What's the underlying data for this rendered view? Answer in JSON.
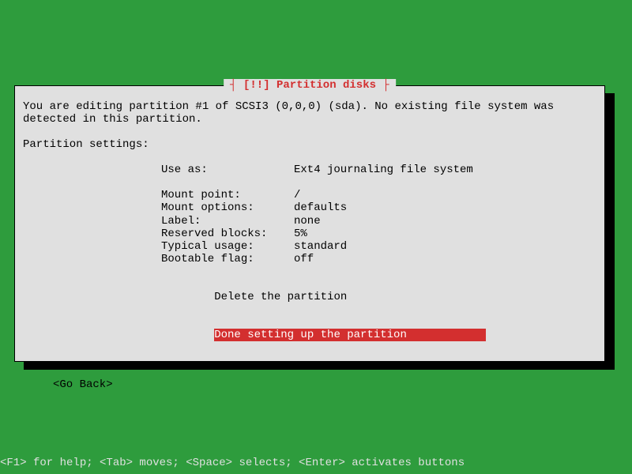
{
  "dialog": {
    "title_prefix": "┤ ",
    "title_mark": "[!!]",
    "title_text": " Partition disks",
    "title_suffix": " ├",
    "intro": "You are editing partition #1 of SCSI3 (0,0,0) (sda). No existing file system was detected in this partition.",
    "settings_heading": "Partition settings:"
  },
  "settings": [
    {
      "key": "Use as:",
      "value": "Ext4 journaling file system"
    },
    {
      "key": "",
      "value": ""
    },
    {
      "key": "Mount point:",
      "value": "/"
    },
    {
      "key": "Mount options:",
      "value": "defaults"
    },
    {
      "key": "Label:",
      "value": "none"
    },
    {
      "key": "Reserved blocks:",
      "value": "5%"
    },
    {
      "key": "Typical usage:",
      "value": "standard"
    },
    {
      "key": "Bootable flag:",
      "value": "off"
    }
  ],
  "actions": {
    "delete": "Delete the partition",
    "done": "Done setting up the partition"
  },
  "go_back": "<Go Back>",
  "help": "<F1> for help; <Tab> moves; <Space> selects; <Enter> activates buttons"
}
